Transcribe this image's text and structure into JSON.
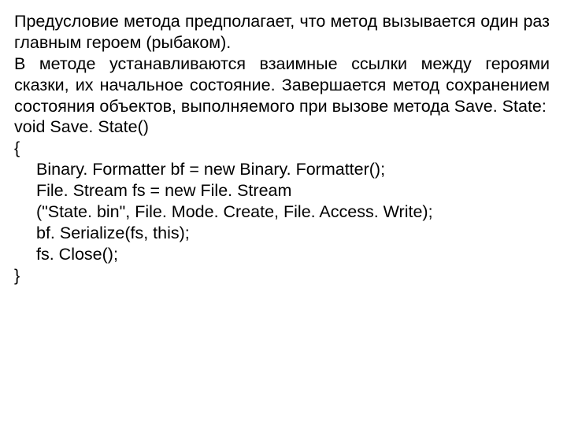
{
  "text": {
    "p1": "Предусловие метода предполагает, что метод вызывается один раз главным героем (рыбаком).",
    "p2": "В методе устанавливаются взаимные ссылки между героями сказки, их начальное состояние. Завершается метод сохранением состояния объектов, выполняемого при вызове метода Save. State:"
  },
  "code": {
    "l1": "void Save. State()",
    "l2": "{",
    "l3": "Binary. Formatter bf = new Binary. Formatter();",
    "l4": "File. Stream fs = new File. Stream",
    "l5": "(\"State. bin\", File. Mode. Create, File. Access. Write);",
    "l6": " bf. Serialize(fs, this);",
    "l7": "fs. Close();",
    "l8": "}"
  }
}
